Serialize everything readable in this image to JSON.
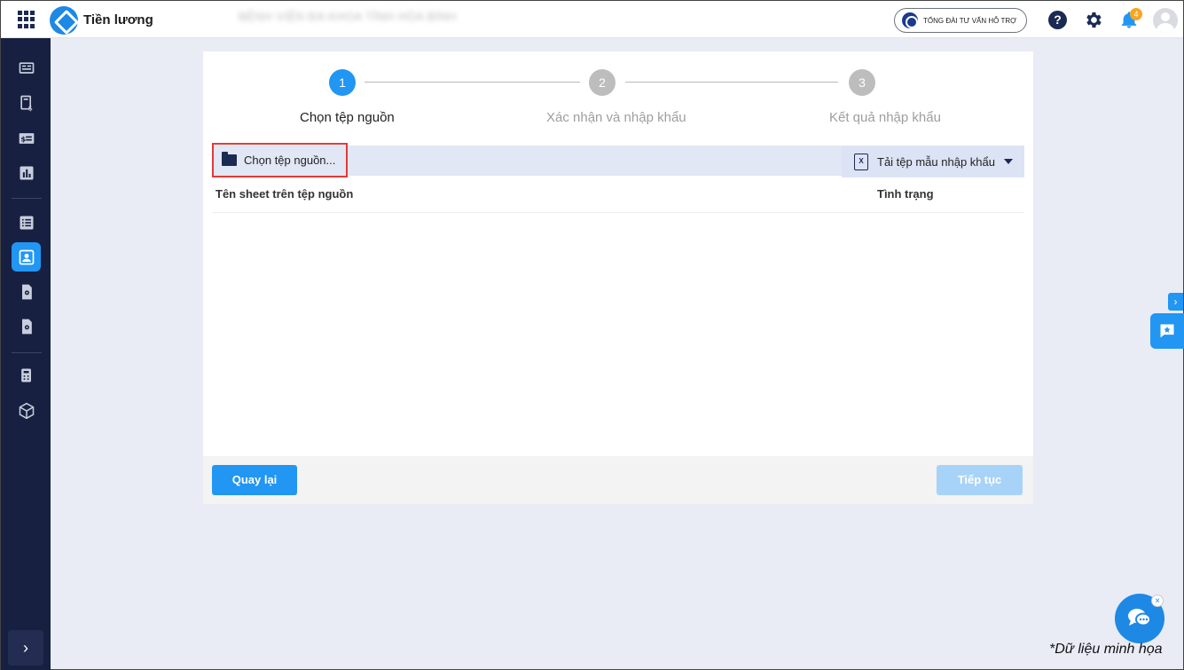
{
  "header": {
    "app_title": "Tiền lương",
    "org_name": "BỆNH VIỆN ĐA KHOA TỈNH HÒA BÌNH",
    "hotline_label": "TỔNG ĐÀI TƯ VẤN HỖ TRỢ",
    "help_label": "?",
    "notification_count": "4"
  },
  "stepper": {
    "steps": [
      {
        "number": "1",
        "label": "Chọn tệp nguồn",
        "state": "active"
      },
      {
        "number": "2",
        "label": "Xác nhận và nhập khẩu",
        "state": "inactive"
      },
      {
        "number": "3",
        "label": "Kết quả nhập khẩu",
        "state": "inactive"
      }
    ]
  },
  "toolbar": {
    "choose_file_label": "Chọn tệp nguồn...",
    "download_template_label": "Tải tệp mẫu nhập khẩu",
    "xls_icon_text": "X"
  },
  "table": {
    "columns": [
      "Tên sheet trên tệp nguồn",
      "Tình trạng"
    ],
    "rows": []
  },
  "footer": {
    "back_label": "Quay lại",
    "next_label": "Tiếp tục"
  },
  "sidebar": {
    "expand_label": "›",
    "items": [
      {
        "icon": "dashboard-icon",
        "active": false
      },
      {
        "icon": "payroll-icon",
        "active": false
      },
      {
        "icon": "salary-icon",
        "active": false
      },
      {
        "icon": "report-icon",
        "active": false
      },
      {
        "icon": "list-icon",
        "active": false
      },
      {
        "icon": "employee-profile-icon",
        "active": true
      },
      {
        "icon": "settings-document-icon",
        "active": false
      },
      {
        "icon": "configuration-document-icon",
        "active": false
      },
      {
        "icon": "calculator-icon",
        "active": false
      },
      {
        "icon": "package-icon",
        "active": false
      }
    ]
  },
  "widgets": {
    "collapse_label": "›",
    "chat_close_label": "×"
  },
  "note": "*Dữ liệu minh họa",
  "colors": {
    "accent": "#2196f3",
    "sidebar_bg": "#172041",
    "highlight_border": "#e53935",
    "badge": "#f5a623"
  }
}
